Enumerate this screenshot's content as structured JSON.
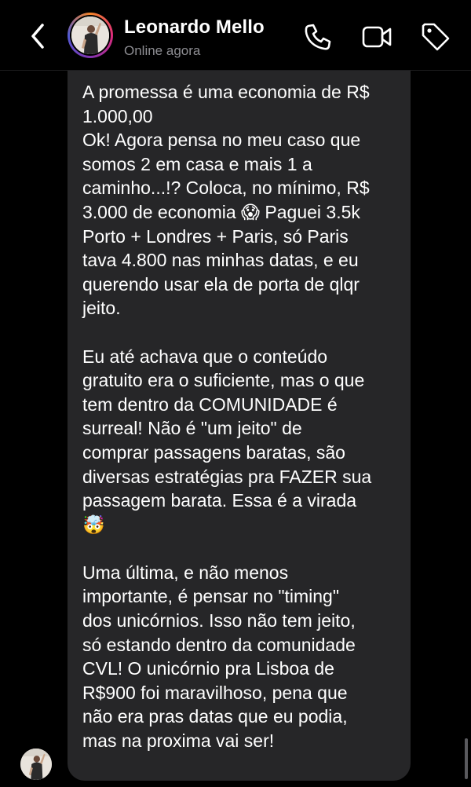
{
  "header": {
    "contact_name": "Leonardo Mello",
    "contact_status": "Online agora",
    "icons": [
      "back-icon",
      "phone-icon",
      "video-camera-icon",
      "tag-icon"
    ]
  },
  "message": {
    "paragraph1": "A promessa é uma economia de R$\n1.000,00\nOk! Agora pensa no meu caso que\nsomos 2 em casa e mais 1 a\ncaminho...!? Coloca, no mínimo, R$\n3.000 de economia 😱 Paguei 3.5k\nPorto + Londres + Paris, só Paris\ntava 4.800 nas minhas datas, e eu\nquerendo usar ela de porta de qlqr\njeito.",
    "paragraph2": "Eu até achava que o conteúdo\ngratuito era o suficiente, mas o que\ntem dentro da COMUNIDADE é\nsurreal! Não é \"um jeito\" de\ncomprar passagens baratas, são\ndiversas estratégias pra FAZER sua\npassagem barata. Essa é a virada\n🤯",
    "paragraph3": "Uma última, e não menos\nimportante, é pensar no \"timing\"\ndos unicórnios. Isso não tem jeito,\nsó estando dentro da comunidade\nCVL! O unicórnio pra Lisboa de\nR$900 foi maravilhoso, pena que\nnão era pras datas que eu podia,\nmas na proxima vai ser!"
  },
  "colors": {
    "background": "#000000",
    "bubble": "#262628",
    "status_text": "#8e8e93",
    "avatar_ring": [
      "#f58529",
      "#dd2a7b",
      "#8134af",
      "#515bd4"
    ]
  }
}
